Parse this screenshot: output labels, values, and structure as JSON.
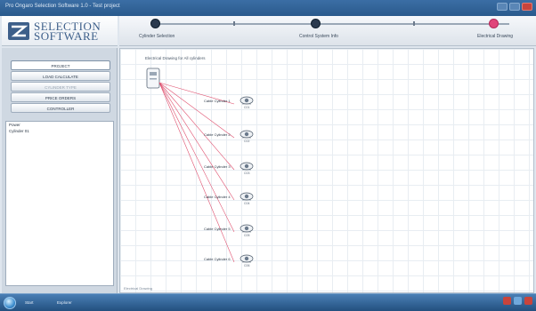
{
  "window": {
    "title": "Pro Ongaro Selection Software 1.0 - Test project"
  },
  "logo": {
    "line1": "SELECTION",
    "line2": "SOFTWARE"
  },
  "steps": [
    {
      "label": "Cylinder Selection",
      "state": "done"
    },
    {
      "label": "",
      "state": "tick"
    },
    {
      "label": "Control System Info",
      "state": "done"
    },
    {
      "label": "",
      "state": "tick"
    },
    {
      "label": "Electrical Drawing",
      "state": "active"
    }
  ],
  "left_panel": {
    "tabs": [
      {
        "label": "PROJECT",
        "state": "active"
      },
      {
        "label": "LOAD CALCULATE",
        "state": "normal"
      },
      {
        "label": "CYLINDER TYPE",
        "state": "muted"
      },
      {
        "label": "PRICE ORDERS",
        "state": "normal"
      },
      {
        "label": "CONTROLLER",
        "state": "normal"
      }
    ],
    "list_items": [
      "Power",
      "Cylinder 01"
    ]
  },
  "canvas": {
    "header": "Electrical Drawing for All cylinders",
    "footer": "Electrical Drawing",
    "root_icon": "device-icon",
    "nodes": [
      {
        "label": "Cable Cylinder 1",
        "sub": "C01",
        "icon": "cylinder-icon"
      },
      {
        "label": "Cable Cylinder 2",
        "sub": "C02",
        "icon": "cylinder-icon"
      },
      {
        "label": "Cable Cylinder 3",
        "sub": "C03",
        "icon": "cylinder-icon"
      },
      {
        "label": "Cable Cylinder 4",
        "sub": "C04",
        "icon": "cylinder-icon"
      },
      {
        "label": "Cable Cylinder 5",
        "sub": "C05",
        "icon": "cylinder-icon"
      },
      {
        "label": "Cable Cylinder 6",
        "sub": "C06",
        "icon": "cylinder-icon"
      }
    ],
    "wire_color": "#e0516f"
  },
  "taskbar": {
    "items": [
      "Start",
      "Explorer"
    ],
    "tray_colors": [
      "#c8443c",
      "#6fa8dc",
      "#c8443c"
    ]
  },
  "colors": {
    "accent": "#e0457a",
    "brand": "#3d5f8a"
  }
}
